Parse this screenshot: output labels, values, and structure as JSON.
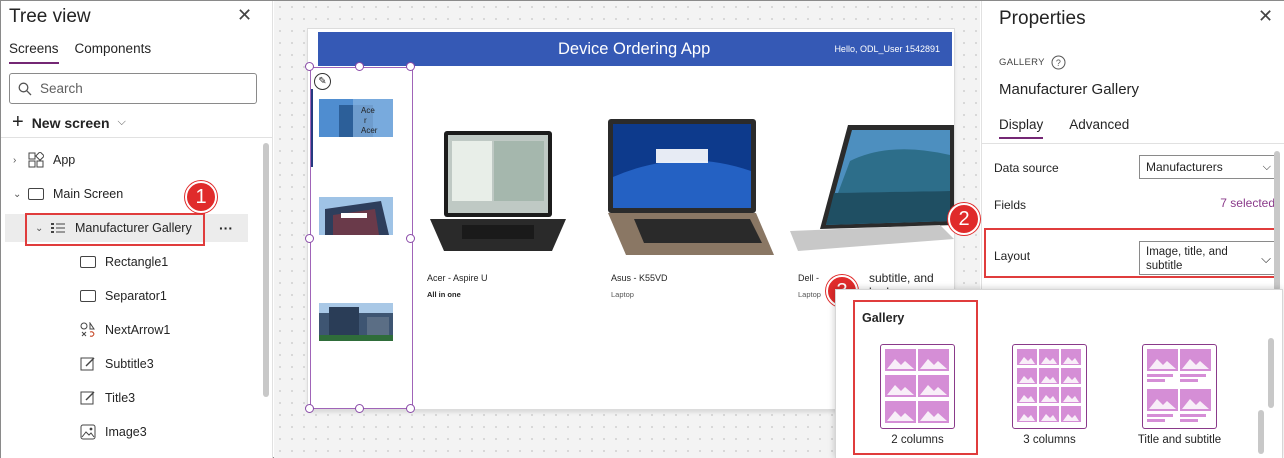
{
  "tree": {
    "title": "Tree view",
    "tabs": [
      "Screens",
      "Components"
    ],
    "search_placeholder": "Search",
    "new_screen": "New screen",
    "nodes": [
      "App",
      "Main Screen",
      "Manufacturer Gallery",
      "Rectangle1",
      "Separator1",
      "NextArrow1",
      "Subtitle3",
      "Title3",
      "Image3"
    ],
    "more": "···"
  },
  "canvas": {
    "app_title": "Device Ordering App",
    "user_greeting": "Hello, ODL_User 1542891",
    "thumb_text": "Ace r Acer",
    "products": [
      {
        "name": "Acer - Aspire U",
        "subtitle": "All in one"
      },
      {
        "name": "Asus - K55VD",
        "subtitle": "Laptop"
      },
      {
        "name": "Dell -",
        "subtitle": "Laptop"
      }
    ],
    "overflow_text": "subtitle, and body"
  },
  "properties": {
    "title": "Properties",
    "control_type": "GALLERY",
    "control_name": "Manufacturer Gallery",
    "tabs": [
      "Display",
      "Advanced"
    ],
    "data_source_label": "Data source",
    "data_source_value": "Manufacturers",
    "fields_label": "Fields",
    "fields_value": "7 selected",
    "layout_label": "Layout",
    "layout_value": "Image, title, and subtitle"
  },
  "gallery_menu": {
    "heading": "Gallery",
    "options": [
      "2 columns",
      "3 columns",
      "Title and subtitle"
    ]
  },
  "badges": [
    "1",
    "2",
    "3"
  ],
  "colors": {
    "accent": "#742774",
    "header_blue": "#3559b5",
    "highlight_red": "#e03c3c",
    "layout_icon": "#d58ed6"
  }
}
